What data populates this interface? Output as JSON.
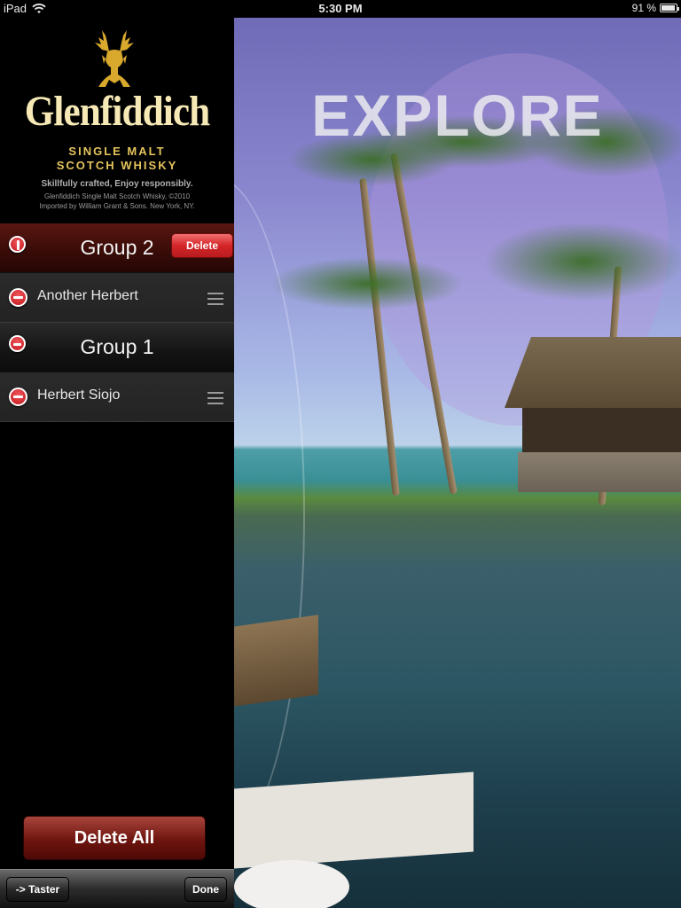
{
  "status_bar": {
    "device": "iPad",
    "time": "5:30 PM",
    "battery_text": "91 %",
    "battery_level": 0.91
  },
  "brand": {
    "name": "Glenfiddich",
    "line1": "SINGLE MALT",
    "line2": "SCOTCH WHISKY",
    "tagline": "Skillfully crafted, Enjoy responsibly.",
    "copyright": "Glenfiddich Single Malt Scotch Whisky, ©2010",
    "importer": "Imported by William Grant & Sons. New York, NY.",
    "colors": {
      "gold": "#e4c35c",
      "cream": "#f6e9b5"
    }
  },
  "list": {
    "rows": [
      {
        "type": "group",
        "label": "Group 2",
        "delete_label": "Delete"
      },
      {
        "type": "item",
        "label": "Another Herbert"
      },
      {
        "type": "group",
        "label": "Group 1"
      },
      {
        "type": "item",
        "label": "Herbert Siojo"
      }
    ]
  },
  "actions": {
    "delete_all": "Delete All"
  },
  "toolbar": {
    "taster": "-> Taster",
    "done": "Done"
  },
  "photo": {
    "title": "EXPLORE"
  },
  "icons": [
    "wifi-icon",
    "battery-icon",
    "stag-logo-icon",
    "minus-circle-icon",
    "reorder-icon"
  ]
}
